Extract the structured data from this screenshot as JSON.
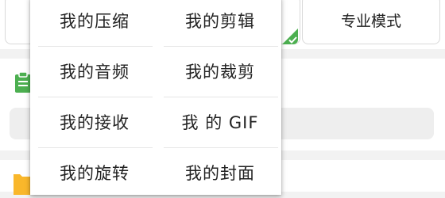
{
  "colors": {
    "accent_green": "#4caf50",
    "folder_yellow": "#f9b72b",
    "background": "#f2f2f2"
  },
  "toolbar": {
    "pro_mode_label": "专业模式"
  },
  "menu": {
    "items": [
      {
        "label": "我的压缩"
      },
      {
        "label": "我的剪辑"
      },
      {
        "label": "我的音频"
      },
      {
        "label": "我的裁剪"
      },
      {
        "label": "我的接收"
      },
      {
        "label": "我 的 GIF"
      },
      {
        "label": "我的旋转"
      },
      {
        "label": "我的封面"
      }
    ]
  },
  "icons": {
    "side_top": "clipboard-icon",
    "side_bottom": "folder-icon",
    "selected_badge": "check-icon"
  }
}
